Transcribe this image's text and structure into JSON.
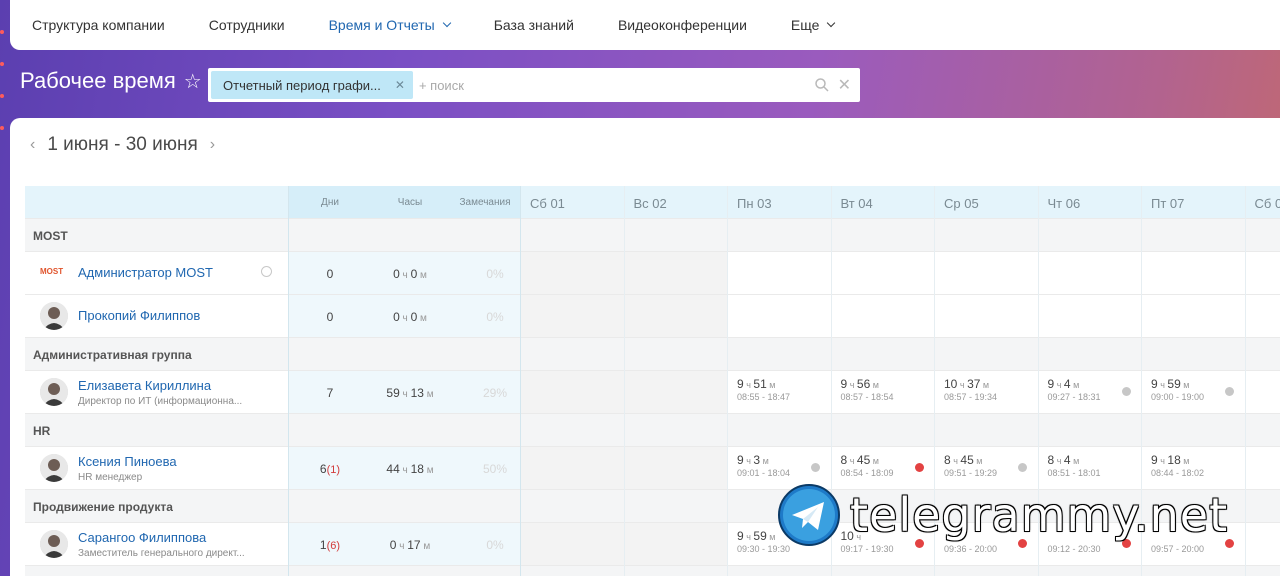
{
  "nav": {
    "items": [
      "Структура компании",
      "Сотрудники",
      "Время и Отчеты",
      "База знаний",
      "Видеоконференции",
      "Еще"
    ]
  },
  "title": "Рабочее время",
  "search": {
    "filter_tag": "Отчетный период графи...",
    "placeholder": "+ поиск"
  },
  "period": "1 июня - 30 июня",
  "table": {
    "summary_headers": [
      "Дни",
      "Часы",
      "Замечания"
    ],
    "day_headers": [
      "Сб 01",
      "Вс 02",
      "Пн 03",
      "Вт 04",
      "Ср 05",
      "Чт 06",
      "Пт 07",
      "Сб 0"
    ],
    "unit_h": "ч",
    "unit_m": "м",
    "groups": [
      {
        "label": "MOST",
        "employees": [
          {
            "name": "Администратор MOST",
            "position": "",
            "days": "0",
            "days_extra": "",
            "hours": "0",
            "minutes": "0",
            "remarks": "0%",
            "logo": "MOST"
          },
          {
            "name": "Прокопий Филиппов",
            "position": "",
            "days": "0",
            "days_extra": "",
            "hours": "0",
            "minutes": "0",
            "remarks": "0%"
          }
        ]
      },
      {
        "label": "Административная группа",
        "employees": [
          {
            "name": "Елизавета Кириллина",
            "position": "Директор по ИТ (информационна...",
            "days": "7",
            "days_extra": "",
            "hours": "59",
            "minutes": "13",
            "remarks": "29%",
            "cells": [
              {
                "h": "9",
                "m": "51",
                "range": "08:55 - 18:47",
                "flag": ""
              },
              {
                "h": "9",
                "m": "56",
                "range": "08:57 - 18:54",
                "flag": ""
              },
              {
                "h": "10",
                "m": "37",
                "range": "08:57 - 19:34",
                "flag": ""
              },
              {
                "h": "9",
                "m": "4",
                "range": "09:27 - 18:31",
                "flag": "grey"
              },
              {
                "h": "9",
                "m": "59",
                "range": "09:00 - 19:00",
                "flag": "grey"
              }
            ]
          }
        ]
      },
      {
        "label": "HR",
        "employees": [
          {
            "name": "Ксения Пиноева",
            "position": "HR менеджер",
            "days": "6",
            "days_extra": "(1)",
            "hours": "44",
            "minutes": "18",
            "remarks": "50%",
            "cells": [
              {
                "h": "9",
                "m": "3",
                "range": "09:01 - 18:04",
                "flag": "grey"
              },
              {
                "h": "8",
                "m": "45",
                "range": "08:54 - 18:09",
                "flag": "red"
              },
              {
                "h": "8",
                "m": "45",
                "range": "09:51 - 19:29",
                "flag": "grey"
              },
              {
                "h": "8",
                "m": "4",
                "range": "08:51 - 18:01",
                "flag": ""
              },
              {
                "h": "9",
                "m": "18",
                "range": "08:44 - 18:02",
                "flag": ""
              }
            ]
          }
        ]
      },
      {
        "label": "Продвижение продукта",
        "employees": [
          {
            "name": "Сарангоо Филиппова",
            "position": "Заместитель генерального директ...",
            "days": "1",
            "days_extra": "(6)",
            "hours": "0",
            "minutes": "17",
            "remarks": "0%",
            "cells": [
              {
                "h": "9",
                "m": "59",
                "range": "09:30 - 19:30",
                "flag": ""
              },
              {
                "h": "10",
                "m": "",
                "range": "09:17 - 19:30",
                "flag": "red"
              },
              {
                "h": "",
                "m": "",
                "range": "09:36 - 20:00",
                "flag": "red"
              },
              {
                "h": "",
                "m": "",
                "range": "09:12 - 20:30",
                "flag": "red"
              },
              {
                "h": "",
                "m": "",
                "range": "09:57 - 20:00",
                "flag": "red"
              }
            ]
          }
        ]
      }
    ]
  },
  "watermark": "telegrammy.net",
  "colors": {
    "accent": "#2067b0",
    "filter_tag_bg": "#bfe7f7",
    "header_bg": "#e4f4fb",
    "warning": "#e34242"
  }
}
